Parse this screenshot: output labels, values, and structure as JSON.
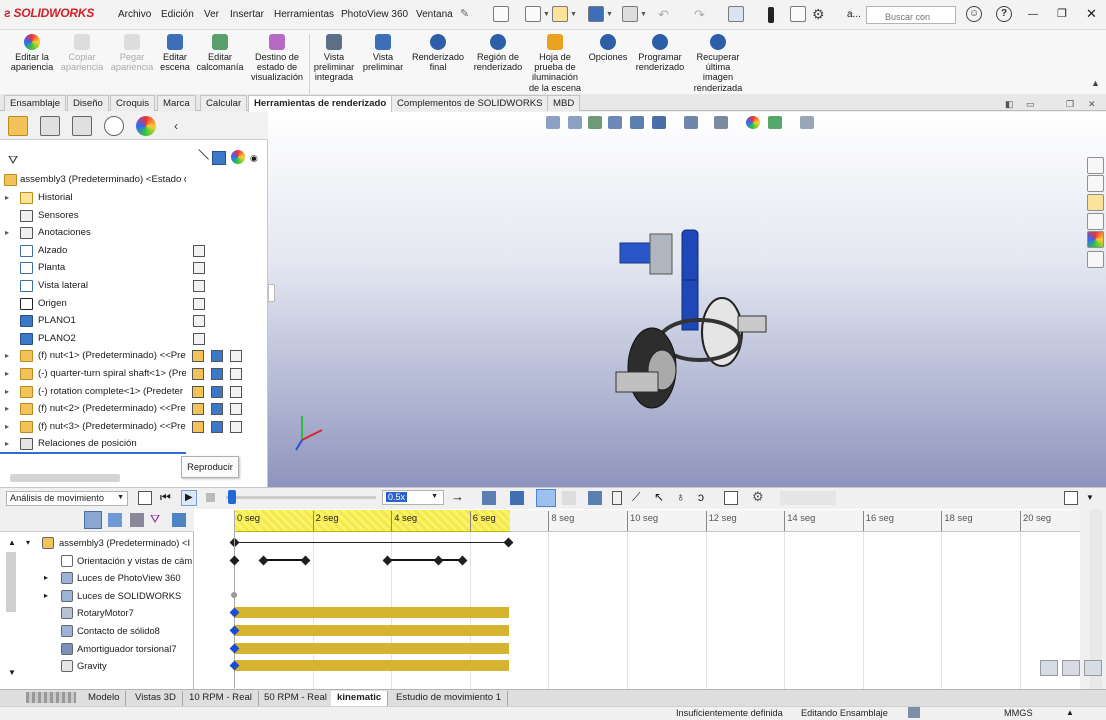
{
  "app": {
    "brand": "SOLIDWORKS",
    "brand_color": "#d11f26"
  },
  "menu": [
    "Archivo",
    "Edición",
    "Ver",
    "Insertar",
    "Herramientas",
    "PhotoView 360",
    "Ventana"
  ],
  "search": {
    "placeholder": "Buscar con",
    "user_label": "a..."
  },
  "ribbon": [
    {
      "label": "Editar la\napariencia",
      "enabled": true
    },
    {
      "label": "Copiar\napariencia",
      "enabled": false
    },
    {
      "label": "Pegar\napariencia",
      "enabled": false
    },
    {
      "label": "Editar\nescena",
      "enabled": true
    },
    {
      "label": "Editar\ncalcomanía",
      "enabled": true
    },
    {
      "label": "Destino de\nestado de\nvisualización",
      "enabled": true
    },
    {
      "label": "Vista\npreliminar\nintegrada",
      "enabled": true
    },
    {
      "label": "Vista\npreliminar",
      "enabled": true
    },
    {
      "label": "Renderizado\nfinal",
      "enabled": true
    },
    {
      "label": "Región de\nrenderizado",
      "enabled": true
    },
    {
      "label": "Hoja de\nprueba de\niluminación\nde la escena",
      "enabled": true
    },
    {
      "label": "Opciones",
      "enabled": true
    },
    {
      "label": "Programar\nrenderizado",
      "enabled": true
    },
    {
      "label": "Recuperar\núltima\nimagen\nrenderizada",
      "enabled": true
    }
  ],
  "command_tabs": [
    "Ensamblaje",
    "Diseño",
    "Croquis",
    "Marca",
    "Calcular",
    "Herramientas de renderizado",
    "Complementos de SOLIDWORKS",
    "MBD"
  ],
  "active_command_tab": "Herramientas de renderizado",
  "feature_tree": {
    "root": "assembly3 (Predeterminado) <Estado d",
    "items": [
      {
        "label": "Historial",
        "expand": true
      },
      {
        "label": "Sensores",
        "expand": false
      },
      {
        "label": "Anotaciones",
        "expand": true
      },
      {
        "label": "Alzado",
        "expand": false
      },
      {
        "label": "Planta",
        "expand": false
      },
      {
        "label": "Vista lateral",
        "expand": false
      },
      {
        "label": "Origen",
        "expand": false
      },
      {
        "label": "PLANO1",
        "expand": false
      },
      {
        "label": "PLANO2",
        "expand": false
      },
      {
        "label": "(f) nut<1> (Predeterminado) <<Pre",
        "expand": true
      },
      {
        "label": "(-) quarter-turn spiral shaft<1> (Pre",
        "expand": true
      },
      {
        "label": "(-) rotation complete<1> (Predeter",
        "expand": true
      },
      {
        "label": "(f) nut<2> (Predeterminado) <<Pre",
        "expand": true
      },
      {
        "label": "(f) nut<3> (Predeterminado) <<Pre",
        "expand": true
      },
      {
        "label": "Relaciones de posición",
        "expand": true
      }
    ]
  },
  "tooltip": "Reproducir",
  "motion": {
    "study_type": "Análisis de movimiento",
    "playback_speed": "0.5x",
    "tree": [
      "assembly3 (Predeterminado) <I",
      "Orientación y vistas de cám",
      "Luces de PhotoView 360",
      "Luces de SOLIDWORKS",
      "RotaryMotor7",
      "Contacto de sólido8",
      "Amortiguador torsional7",
      "Gravity"
    ],
    "time_labels": [
      "0 seg",
      "2 seg",
      "4 seg",
      "6 seg",
      "8 seg",
      "10 seg",
      "12 seg",
      "14 seg",
      "16 seg",
      "18 seg",
      "20 seg"
    ],
    "duration_seconds": 7,
    "orientation_keys_seconds": [
      0.75,
      1.8,
      3.9,
      5.2,
      5.8
    ]
  },
  "bottom_tabs": [
    "Modelo",
    "Vistas 3D",
    "10 RPM - Real",
    "50 RPM - Real",
    "kinematic",
    "Estudio de movimiento 1"
  ],
  "active_bottom_tab": "kinematic",
  "status": {
    "definition": "Insuficientemente definida",
    "mode": "Editando Ensamblaje",
    "units": "MMGS"
  }
}
